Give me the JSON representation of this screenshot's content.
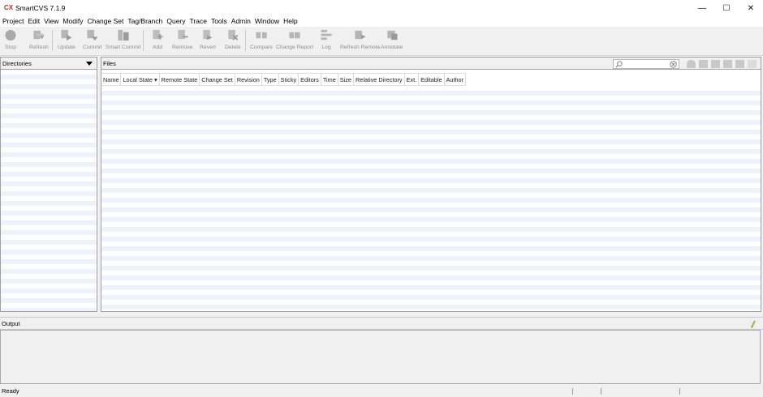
{
  "window": {
    "title": "SmartCVS 7.1.9",
    "app_icon_glyph": "CX",
    "minimize": "—",
    "maximize": "☐",
    "close": "✕"
  },
  "menu": [
    "Project",
    "Edit",
    "View",
    "Modify",
    "Change Set",
    "Tag/Branch",
    "Query",
    "Trace",
    "Tools",
    "Admin",
    "Window",
    "Help"
  ],
  "toolbar": {
    "buttons": [
      {
        "label": "Stop",
        "icon": "stop-icon"
      },
      {
        "label": "Refresh",
        "icon": "refresh-icon"
      },
      {
        "label": "Update",
        "icon": "update-icon"
      },
      {
        "label": "Commit",
        "icon": "commit-icon"
      },
      {
        "label": "Smart Commit",
        "icon": "smart-commit-icon"
      },
      {
        "label": "Add",
        "icon": "add-icon"
      },
      {
        "label": "Remove",
        "icon": "remove-icon"
      },
      {
        "label": "Revert",
        "icon": "revert-icon"
      },
      {
        "label": "Delete",
        "icon": "delete-icon"
      },
      {
        "label": "Compare",
        "icon": "compare-icon"
      },
      {
        "label": "Change Report",
        "icon": "change-report-icon"
      },
      {
        "label": "Log",
        "icon": "log-icon"
      },
      {
        "label": "Refresh Remote",
        "icon": "refresh-remote-icon"
      },
      {
        "label": "Annotate",
        "icon": "annotate-icon"
      }
    ]
  },
  "directories": {
    "title": "Directories"
  },
  "files": {
    "title": "Files",
    "search_placeholder": "",
    "columns": [
      "Name",
      "Local State ▾",
      "Remote State",
      "Change Set",
      "Revision",
      "Type",
      "Sticky",
      "Editors",
      "Time",
      "Size",
      "Relative Directory",
      "Ext.",
      "Editable",
      "Author"
    ]
  },
  "output": {
    "title": "Output"
  },
  "status": {
    "text": "Ready"
  },
  "colors": {
    "stripe": "#eef3fb",
    "icon_gray": "#a9a9a9",
    "app_red": "#d0271d"
  }
}
